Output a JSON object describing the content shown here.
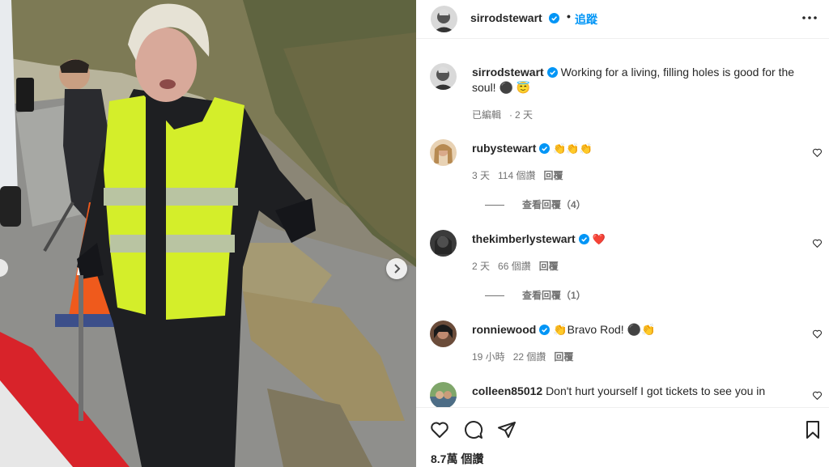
{
  "header": {
    "username": "sirrodstewart",
    "separator": "•",
    "follow_label": "追蹤"
  },
  "caption": {
    "username": "sirrodstewart",
    "text": "Working for a living, filling holes is good for the soul! ⚫ 😇",
    "edited": "已編輯",
    "time": "2 天"
  },
  "comments": [
    {
      "username": "rubystewart",
      "verified": true,
      "text": "👏👏👏",
      "time": "3 天",
      "likes": "114 個讚",
      "reply_label": "回覆",
      "view_replies": "查看回覆（4）"
    },
    {
      "username": "thekimberlystewart",
      "verified": true,
      "text": "❤️",
      "time": "2 天",
      "likes": "66 個讚",
      "reply_label": "回覆",
      "view_replies": "查看回覆（1）"
    },
    {
      "username": "ronniewood",
      "verified": true,
      "text": "👏Bravo Rod! ⚫👏",
      "time": "19 小時",
      "likes": "22 個讚",
      "reply_label": "回覆",
      "view_replies": ""
    },
    {
      "username": "colleen85012",
      "verified": false,
      "text": "Don't hurt yourself I got tickets to see you in",
      "time": "",
      "likes": "",
      "reply_label": "",
      "view_replies": ""
    }
  ],
  "footer": {
    "likes": "8.7萬 個讚"
  },
  "icons": {
    "verified": "verified-badge-icon",
    "like": "heart-icon",
    "comment": "comment-icon",
    "share": "send-icon",
    "save": "bookmark-icon",
    "more": "more-options-icon",
    "next": "chevron-right-icon"
  },
  "colors": {
    "follow_blue": "#0095f6",
    "verified_blue": "#0095f6",
    "muted_text": "#737373",
    "border": "#efefef",
    "vest_yellow": "#d4ee2a"
  }
}
